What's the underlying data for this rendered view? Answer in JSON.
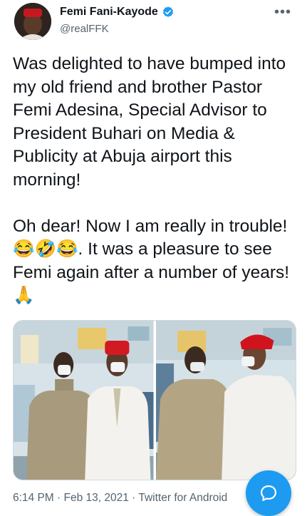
{
  "author": {
    "name": "Femi Fani-Kayode",
    "handle": "@realFFK",
    "verified_icon": "verified-badge-icon",
    "avatar_icon": "profile-photo"
  },
  "more_label": "•••",
  "tweet": {
    "paragraph1": "Was delighted to have bumped into my old friend and brother Pastor Femi Adesina, Special Advisor to President Buhari on Media & Publicity at Abuja airport this morning!",
    "paragraph2_line1": "Oh dear! Now I am really in trouble!",
    "emojis": "😂🤣😂",
    "paragraph2_rest": ". It was a pleasure to see Femi again after a number of years! ",
    "emoji_end": "🙏"
  },
  "media": {
    "photos": [
      "photo-1",
      "photo-2"
    ]
  },
  "footer": {
    "time": "6:14 PM",
    "sep1": " · ",
    "date": "Feb 13, 2021",
    "sep2": " · ",
    "source": "Twitter for Android"
  },
  "compose_icon": "compose-reply-icon",
  "colors": {
    "accent": "#1d9bf0",
    "text": "#0f1419",
    "secondary": "#536471"
  }
}
